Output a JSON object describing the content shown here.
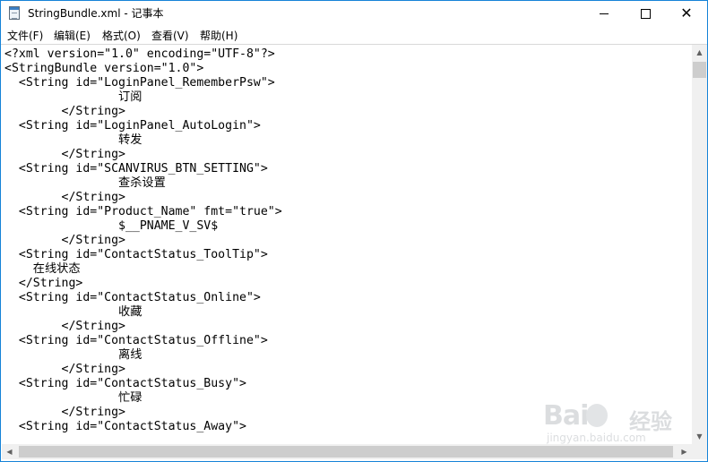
{
  "window": {
    "title": "StringBundle.xml - 记事本",
    "controls": {
      "minimize": "—",
      "maximize": "☐",
      "close": "✕"
    }
  },
  "menu": {
    "items": [
      {
        "label": "文件(F)"
      },
      {
        "label": "编辑(E)"
      },
      {
        "label": "格式(O)"
      },
      {
        "label": "查看(V)"
      },
      {
        "label": "帮助(H)"
      }
    ]
  },
  "editor": {
    "lines": [
      "<?xml version=\"1.0\" encoding=\"UTF-8\"?>",
      "<StringBundle version=\"1.0\">",
      "  <String id=\"LoginPanel_RememberPsw\">",
      "                订阅",
      "        </String>",
      "  <String id=\"LoginPanel_AutoLogin\">",
      "                转发",
      "        </String>",
      "  <String id=\"SCANVIRUS_BTN_SETTING\">",
      "                查杀设置",
      "        </String>",
      "  <String id=\"Product_Name\" fmt=\"true\">",
      "                $__PNAME_V_SV$",
      "        </String>",
      "  <String id=\"ContactStatus_ToolTip\">",
      "    在线状态",
      "  </String>",
      "  <String id=\"ContactStatus_Online\">",
      "                收藏",
      "        </String>",
      "  <String id=\"ContactStatus_Offline\">",
      "                离线",
      "        </String>",
      "  <String id=\"ContactStatus_Busy\">",
      "                忙碌",
      "        </String>",
      "  <String id=\"ContactStatus_Away\">"
    ]
  },
  "watermark": {
    "logo": "Bai",
    "logo_cn": "经验",
    "url": "jingyan.baidu.com"
  },
  "colors": {
    "border": "#1683d8",
    "scrollbar_track": "#f0f0f0",
    "scrollbar_thumb": "#cdcdcd"
  }
}
